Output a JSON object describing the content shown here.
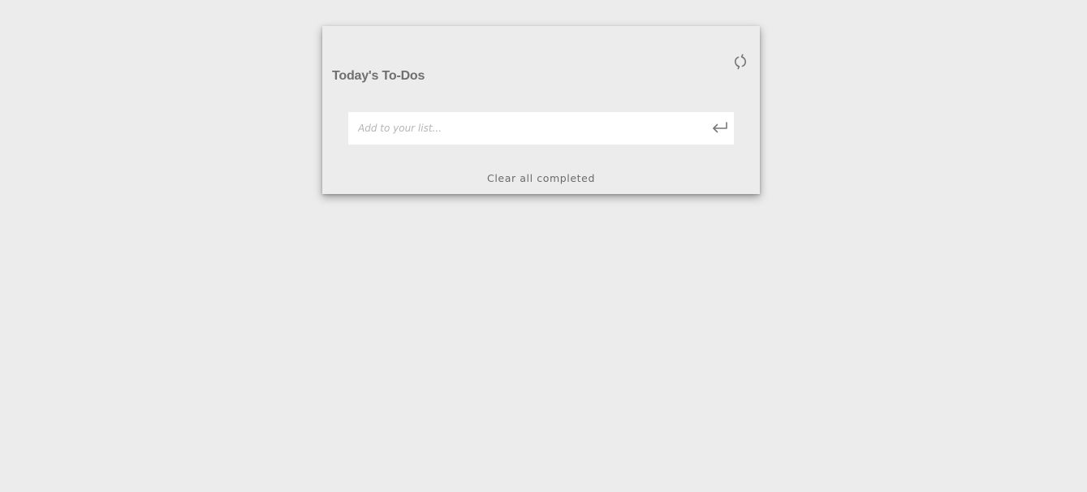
{
  "todo_card": {
    "title": "Today's To-Dos",
    "refresh_icon": "refresh-icon",
    "input": {
      "placeholder": "Add to your list...",
      "value": ""
    },
    "submit_icon": "enter-arrow-icon",
    "clear_completed_label": "Clear all completed"
  },
  "colors": {
    "page_background": "#ececec",
    "card_background": "#ececec",
    "input_background": "#ffffff",
    "title_text": "#6f6f6f",
    "placeholder_text": "#b5b5b5",
    "icon": "#777777"
  }
}
